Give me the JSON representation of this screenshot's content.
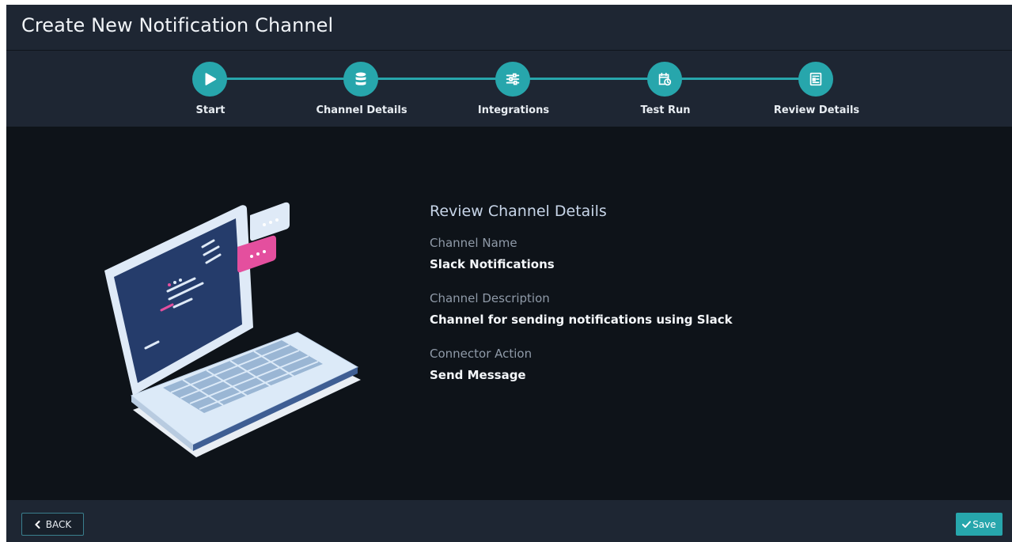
{
  "header": {
    "title": "Create New Notification Channel"
  },
  "stepper": {
    "steps": [
      {
        "label": "Start",
        "icon": "play-icon"
      },
      {
        "label": "Channel Details",
        "icon": "database-icon"
      },
      {
        "label": "Integrations",
        "icon": "sliders-icon"
      },
      {
        "label": "Test Run",
        "icon": "calendar-clock-icon"
      },
      {
        "label": "Review Details",
        "icon": "review-document-icon"
      }
    ]
  },
  "review": {
    "title": "Review Channel Details",
    "channel_name_label": "Channel Name",
    "channel_name_value": "Slack Notifications",
    "channel_description_label": "Channel Description",
    "channel_description_value": "Channel for sending notifications using Slack",
    "connector_action_label": "Connector Action",
    "connector_action_value": "Send Message"
  },
  "footer": {
    "back_label": "BACK",
    "save_label": "Save"
  },
  "colors": {
    "accent": "#27a6ac",
    "header_bg": "#1e2633",
    "main_bg": "#0e1319"
  }
}
